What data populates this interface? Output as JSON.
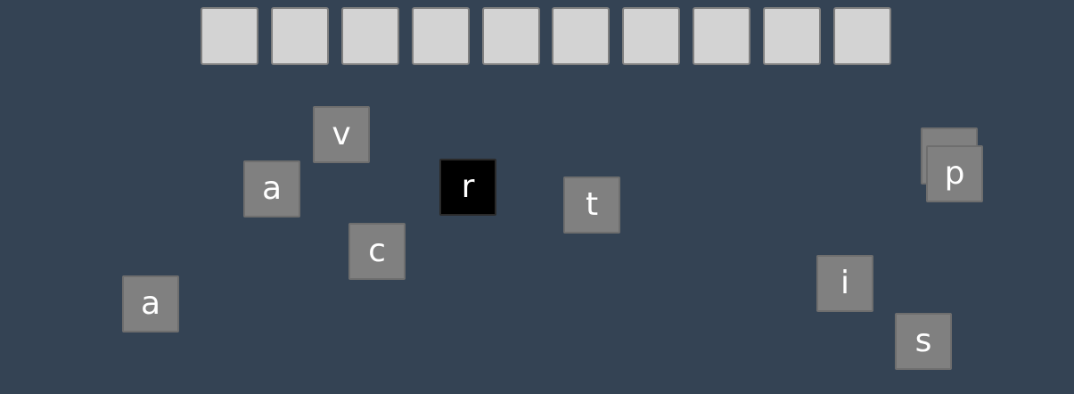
{
  "game": {
    "answer_slots": [
      "",
      "",
      "",
      "",
      "",
      "",
      "",
      "",
      "",
      ""
    ],
    "tiles": [
      {
        "letter": "",
        "state": "stacked-under"
      },
      {
        "letter": "p",
        "state": "normal"
      },
      {
        "letter": "v",
        "state": "normal"
      },
      {
        "letter": "a",
        "state": "normal"
      },
      {
        "letter": "r",
        "state": "selected"
      },
      {
        "letter": "t",
        "state": "normal"
      },
      {
        "letter": "c",
        "state": "normal"
      },
      {
        "letter": "i",
        "state": "normal"
      },
      {
        "letter": "a",
        "state": "normal"
      },
      {
        "letter": "s",
        "state": "normal"
      }
    ]
  },
  "colors": {
    "background": "#344354",
    "slot": "#d3d3d3",
    "tile": "#808080",
    "tile_selected": "#000000",
    "tile_text": "#ffffff"
  }
}
